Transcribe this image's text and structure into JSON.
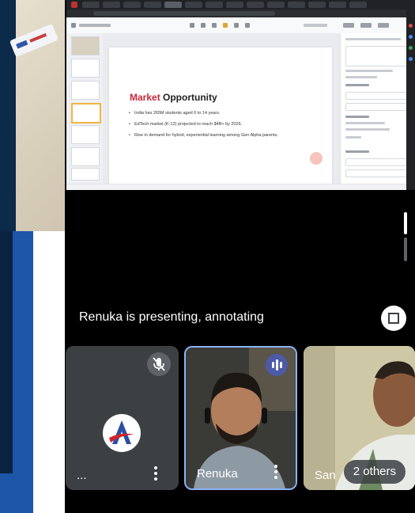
{
  "slide": {
    "title_accent": "Market",
    "title_rest": " Opportunity",
    "bullets": [
      "India has 265M students aged 6 to 14 years.",
      "EdTech market (K-12) projected to reach $4B+ by 2026.",
      "Rise in demand for hybrid, experiential learning among Gen Alpha parents."
    ]
  },
  "meeting": {
    "presenting_label": "Renuka is presenting, annotating",
    "participants": [
      {
        "name": "...",
        "muted": true
      },
      {
        "name": "Renuka",
        "speaking": true
      },
      {
        "name": "San"
      }
    ],
    "others_label": "2 others"
  },
  "icons": {
    "fullscreen": "fullscreen-icon",
    "mic_off": "mic-off-icon",
    "speaking": "audio-level-icon",
    "more": "more-vert-icon"
  },
  "colors": {
    "accent_red": "#c7283a",
    "active_border": "#8ab4f8",
    "speaking_badge": "#4c5aa8"
  }
}
